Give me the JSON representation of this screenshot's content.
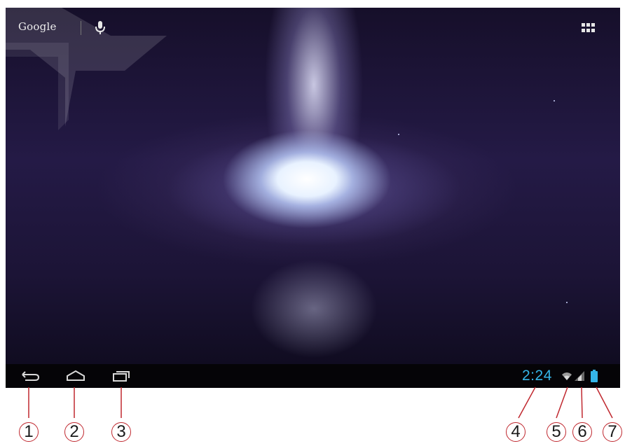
{
  "search_bar": {
    "google_label": "Google",
    "mic_icon": "mic-icon"
  },
  "apps_button": {
    "icon": "apps-grid-icon"
  },
  "navigation_bar": {
    "back": {
      "icon": "back-icon"
    },
    "home": {
      "icon": "home-icon"
    },
    "recents": {
      "icon": "recent-apps-icon"
    }
  },
  "status": {
    "time": "2:24",
    "wifi": "wifi-icon",
    "signal": "cell-signal-icon",
    "battery": "battery-icon",
    "clock_color": "#35b5e8"
  },
  "callouts": [
    "1",
    "2",
    "3",
    "4",
    "5",
    "6",
    "7"
  ],
  "colors": {
    "callout_circle": "#c0282f",
    "navbar": "#050407"
  }
}
